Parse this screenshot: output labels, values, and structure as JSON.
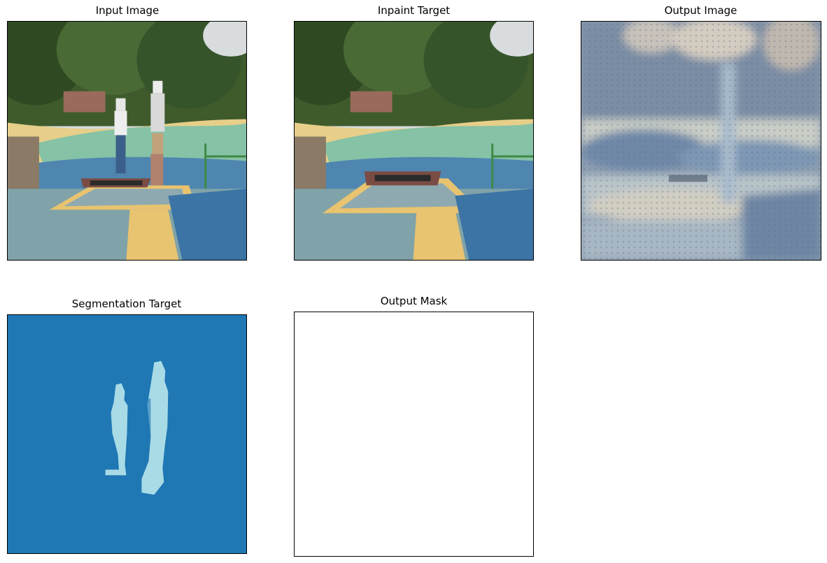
{
  "figure": {
    "panels": [
      {
        "title": "Input Image"
      },
      {
        "title": "Inpaint Target"
      },
      {
        "title": "Output Image"
      },
      {
        "title": "Segmentation Target"
      },
      {
        "title": "Output Mask"
      }
    ]
  },
  "colors": {
    "segmentation_background": "#1f77b4",
    "segmentation_foreground": "#a8dbe6",
    "mask_background": "#ffffff"
  }
}
